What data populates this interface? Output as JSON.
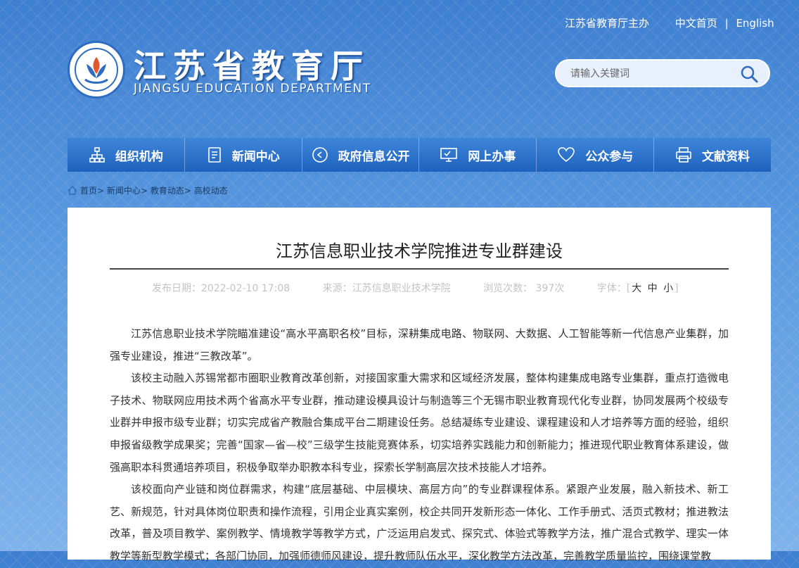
{
  "header": {
    "sponsor": "江苏省教育厅主办",
    "lang_cn": "中文首页",
    "lang_sep": "|",
    "lang_en": "English",
    "logo_cn": "江苏省教育厅",
    "logo_en": "JIANGSU EDUCATION DEPARTMENT",
    "search_placeholder": "请输入关键词"
  },
  "nav": [
    {
      "label": "组织机构",
      "icon": "org-chart-icon"
    },
    {
      "label": "新闻中心",
      "icon": "document-icon"
    },
    {
      "label": "政府信息公开",
      "icon": "play-circle-icon"
    },
    {
      "label": "网上办事",
      "icon": "monitor-icon"
    },
    {
      "label": "公众参与",
      "icon": "heart-icon"
    },
    {
      "label": "文献资料",
      "icon": "printer-icon"
    }
  ],
  "breadcrumb": [
    "首页",
    "新闻中心",
    "教育动态",
    "高校动态"
  ],
  "breadcrumb_sep": ">",
  "article": {
    "title": "江苏信息职业技术学院推进专业群建设",
    "publish": "发布日期：2022-02-10 17:08",
    "source": "来源：江苏信息职业技术学院",
    "views": "浏览次数： 397次",
    "fontsize_label": "字体：[",
    "fs_large": "大",
    "fs_medium": "中",
    "fs_small": "小",
    "fontsize_close": "]",
    "paragraphs": [
      "江苏信息职业技术学院瞄准建设“高水平高职名校”目标，深耕集成电路、物联网、大数据、人工智能等新一代信息产业集群，加强专业建设，推进“三教改革”。",
      "该校主动融入苏锡常都市圈职业教育改革创新，对接国家重大需求和区域经济发展，整体构建集成电路专业集群，重点打造微电子技术、物联网应用技术两个省高水平专业群，推动建设模具设计与制造等三个无锡市职业教育现代化专业群，协同发展两个校级专业群并申报市级专业群；切实完成省产教融合集成平台二期建设任务。总结凝练专业建设、课程建设和人才培养等方面的经验，组织申报省级教学成果奖；完善“国家—省—校”三级学生技能竞赛体系，切实培养实践能力和创新能力；推进现代职业教育体系建设，做强高职本科贯通培养项目，积极争取举办职教本科专业，探索长学制高层次技术技能人才培养。",
      "该校面向产业链和岗位群需求，构建“底层基础、中层模块、高层方向”的专业群课程体系。紧跟产业发展，融入新技术、新工艺、新规范，针对具体岗位职责和操作流程，引用企业真实案例，校企共同开发新形态一体化、工作手册式、活页式教材；推进教法改革，普及项目教学、案例教学、情境教学等教学方式，广泛运用启发式、探究式、体验式等教学方法，推广混合式教学、理实一体教学等新型教学模式；各部门协同，加强师德师风建设，提升教师队伍水平，深化教学方法改革，完善教学质量监控，围绕课堂教"
    ]
  }
}
